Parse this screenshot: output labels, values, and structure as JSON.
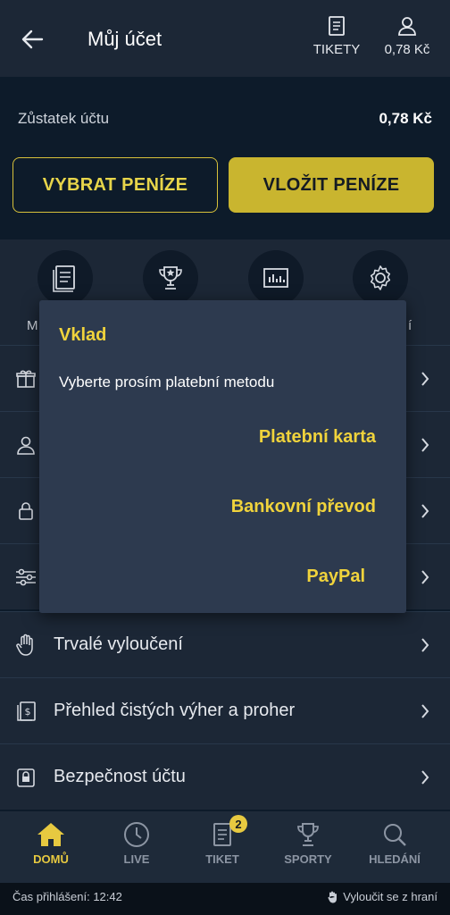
{
  "header": {
    "title": "Můj účet",
    "tickets_label": "TIKETY",
    "balance_label": "0,78 Kč"
  },
  "account": {
    "balance_label": "Zůstatek účtu",
    "balance_value": "0,78 Kč",
    "withdraw_label": "VYBRAT PENÍZE",
    "deposit_label": "VLOŽIT PENÍZE"
  },
  "quick_icons": {
    "visible_fragments": [
      "M",
      "í"
    ]
  },
  "menu": {
    "items": [
      {
        "label": "Trvalé vyloučení"
      },
      {
        "label": "Přehled čistých výher a proher"
      },
      {
        "label": "Bezpečnost účtu"
      }
    ]
  },
  "modal": {
    "title": "Vklad",
    "message": "Vyberte prosím platební metodu",
    "options": [
      "Platební karta",
      "Bankovní převod",
      "PayPal"
    ]
  },
  "bottom_nav": [
    {
      "label": "DOMŮ",
      "icon": "home-icon",
      "active": true
    },
    {
      "label": "LIVE",
      "icon": "clock-icon"
    },
    {
      "label": "TIKET",
      "icon": "ticket-icon",
      "badge": "2"
    },
    {
      "label": "SPORTY",
      "icon": "trophy-icon"
    },
    {
      "label": "HLEDÁNÍ",
      "icon": "search-icon"
    }
  ],
  "status_bar": {
    "login_time": "Čas přihlášení: 12:42",
    "self_exclude": "Vyloučit se z hraní"
  },
  "colors": {
    "accent": "#e7c940",
    "background": "#0d1b2a",
    "panel": "#1c2736",
    "modal": "#2d3a4f"
  }
}
